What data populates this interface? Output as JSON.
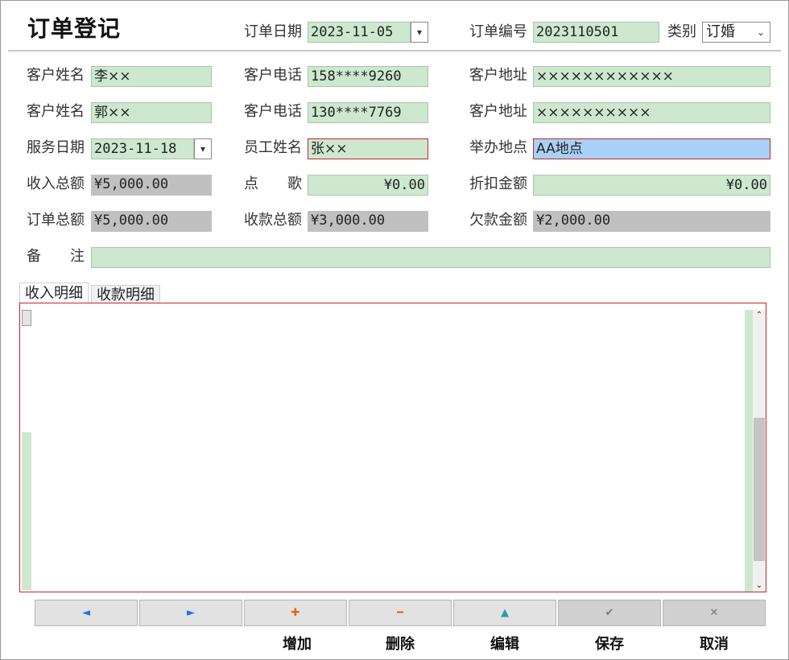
{
  "header": {
    "title": "订单登记",
    "order_date_label": "订单日期",
    "order_date_value": "2023-11-05",
    "order_no_label": "订单编号",
    "order_no_value": "2023110501",
    "category_label": "类别",
    "category_value": "订婚"
  },
  "rows": {
    "r1": {
      "name_label": "客户姓名",
      "name_value": "李××",
      "phone_label": "客户电话",
      "phone_value": "158****9260",
      "addr_label": "客户地址",
      "addr_value": "××××××××××××"
    },
    "r2": {
      "name_label": "客户姓名",
      "name_value": "郭××",
      "phone_label": "客户电话",
      "phone_value": "130****7769",
      "addr_label": "客户地址",
      "addr_value": "××××××××××"
    },
    "r3": {
      "service_date_label": "服务日期",
      "service_date_value": "2023-11-18",
      "staff_label": "员工姓名",
      "staff_value": "张××",
      "venue_label": "举办地点",
      "venue_value": "AA地点"
    },
    "r4": {
      "income_label": "收入总额",
      "income_value": "¥5,000.00",
      "song_label": "点　　歌",
      "song_value": "¥0.00",
      "discount_label": "折扣金额",
      "discount_value": "¥0.00"
    },
    "r5": {
      "order_total_label": "订单总额",
      "order_total_value": "¥5,000.00",
      "received_label": "收款总额",
      "received_value": "¥3,000.00",
      "owed_label": "欠款金额",
      "owed_value": "¥2,000.00"
    },
    "r6": {
      "remark_label": "备　　注",
      "remark_value": ""
    }
  },
  "tabs": [
    "收入明细",
    "收款明细"
  ],
  "nav": {
    "prev": "◄",
    "next": "►",
    "add": "✚",
    "delete": "━",
    "edit": "▲",
    "save": "✔",
    "cancel": "✕"
  },
  "actions": {
    "add": "增加",
    "delete": "删除",
    "edit": "编辑",
    "save": "保存",
    "cancel": "取消"
  },
  "icons": {
    "prev": "triangle-left-icon",
    "next": "triangle-right-icon",
    "add": "plus-icon",
    "delete": "minus-icon",
    "edit": "triangle-up-icon",
    "save": "check-icon",
    "cancel": "close-icon"
  },
  "colors": {
    "field_green": "#cde8cf",
    "field_gray": "#c0c0c0",
    "focus_blue": "#a9d1f7",
    "error_border": "#c0272d",
    "nav_blue": "#1a73e8",
    "nav_orange": "#e06a10",
    "nav_teal": "#2a9bb0"
  }
}
